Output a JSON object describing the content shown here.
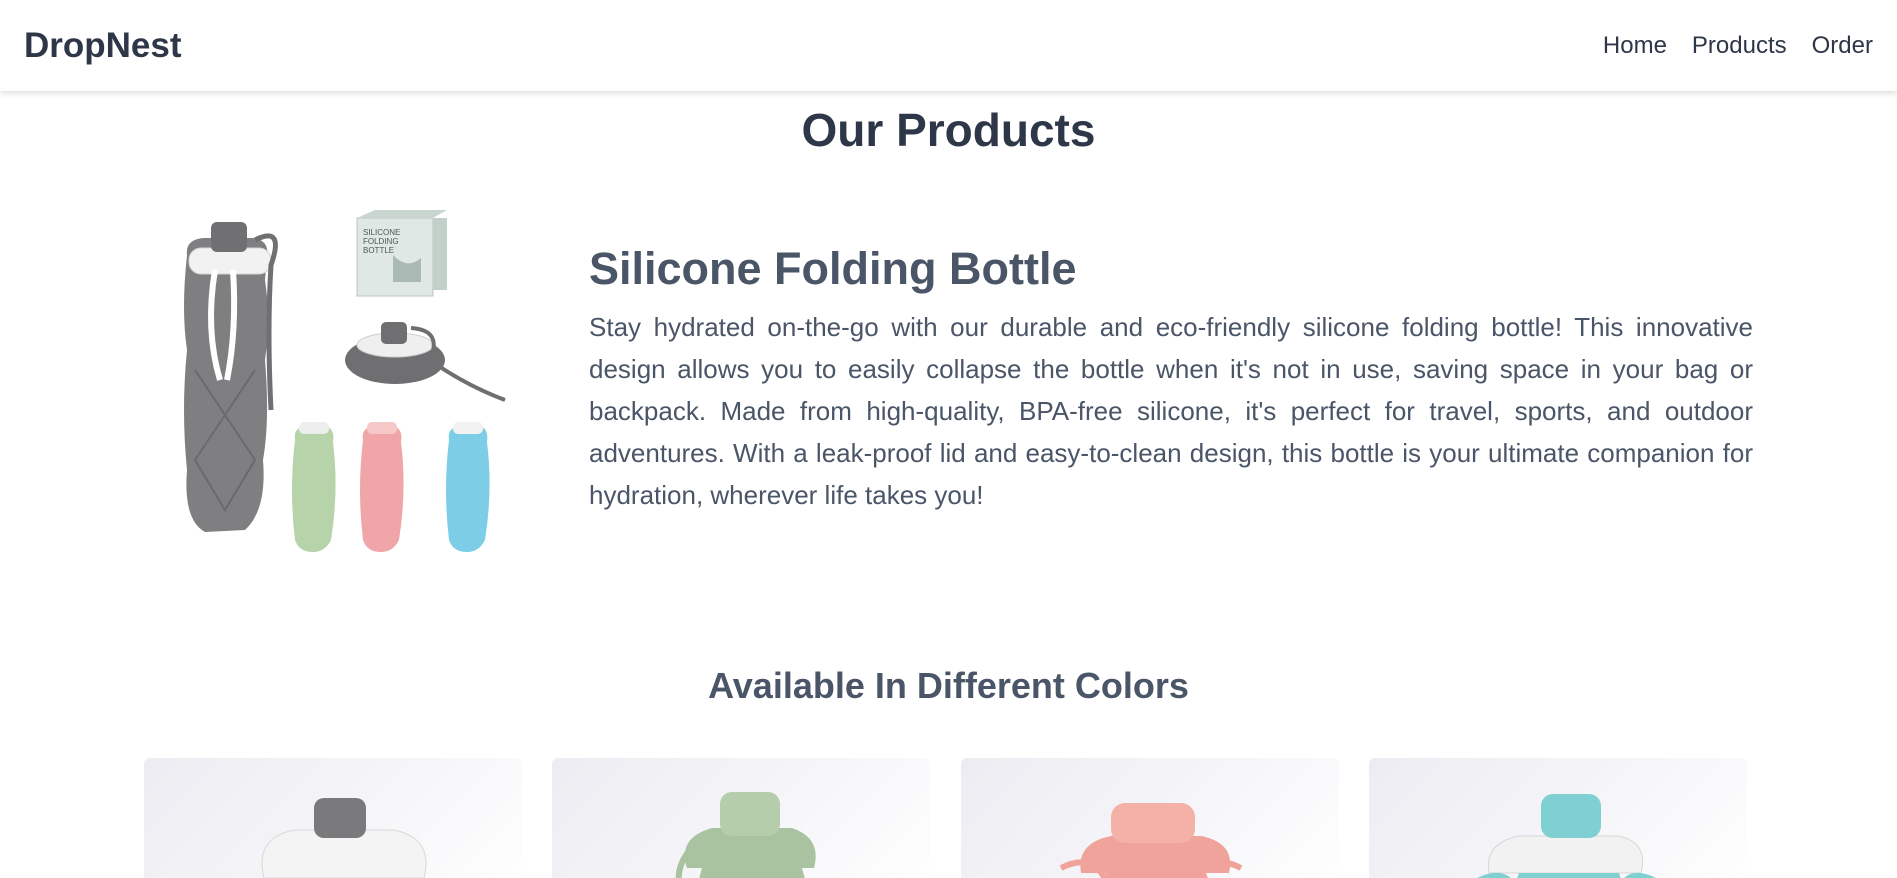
{
  "brand": "DropNest",
  "nav": [
    {
      "label": "Home"
    },
    {
      "label": "Products"
    },
    {
      "label": "Order"
    }
  ],
  "page_title": "Our Products",
  "product": {
    "name": "Silicone Folding Bottle",
    "description": "Stay hydrated on-the-go with our durable and eco-friendly silicone folding bottle! This innovative design allows you to easily collapse the bottle when it's not in use, saving space in your bag or backpack. Made from high-quality, BPA-free silicone, it's perfect for travel, sports, and outdoor adventures. With a leak-proof lid and easy-to-clean design, this bottle is your ultimate companion for hydration, wherever life takes you!",
    "box_text": [
      "SILICONE",
      "FOLDING",
      "BOTTLE"
    ]
  },
  "colors_title": "Available In Different Colors",
  "color_variants": [
    {
      "name": "gray",
      "color": "#7a7a7c"
    },
    {
      "name": "green",
      "color": "#a9c29f"
    },
    {
      "name": "pink",
      "color": "#f0a39a"
    },
    {
      "name": "blue",
      "color": "#7fd0d2"
    }
  ]
}
